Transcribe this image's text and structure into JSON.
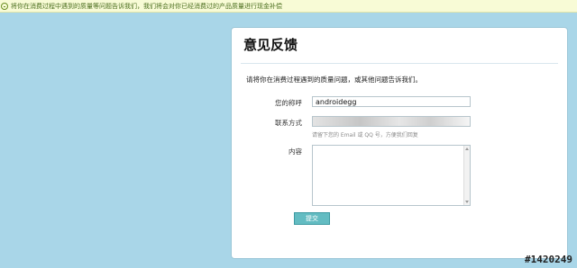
{
  "notice": {
    "text": "将你在消费过程中遇到的质量等问题告诉我们，我们将会对你已经消费过的产品质量进行现金补偿"
  },
  "feedback": {
    "title": "意见反馈",
    "intro": "请将你在消费过程遇到的质量问题，或其他问题告诉我们。",
    "name_label": "您的称呼",
    "name_value": "androidegg",
    "contact_label": "联系方式",
    "contact_hint": "请留下您的 Email 或 QQ 号，方便我们回复",
    "content_label": "内容",
    "submit_label": "提交"
  },
  "watermark": "#1420249"
}
